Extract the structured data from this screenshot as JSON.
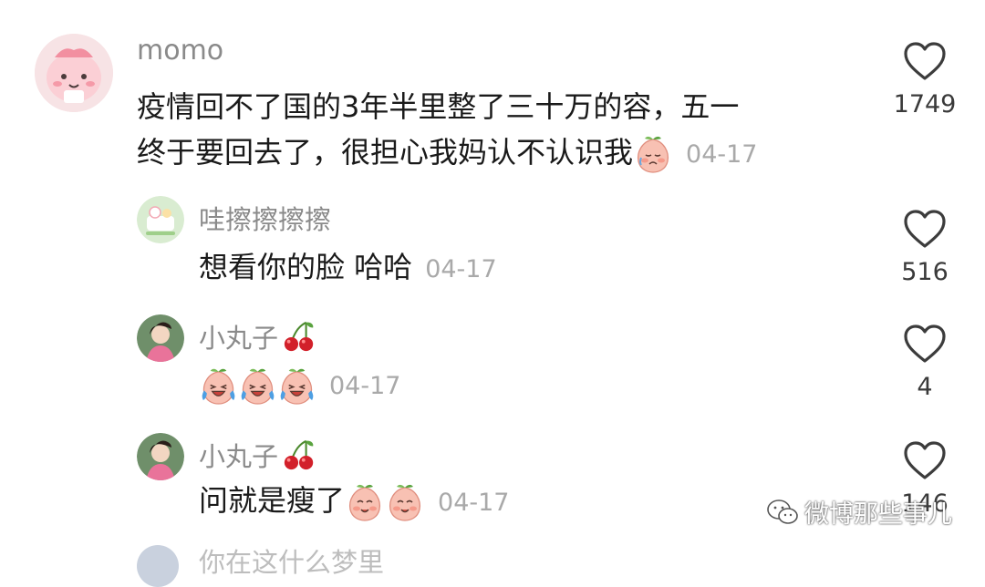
{
  "comments": [
    {
      "user": "momo",
      "text_line1": "疫情回不了国的3年半里整了三十万的容，五一",
      "text_line2": "终于要回去了，很担心我妈认不认识我",
      "emoji": "crying-peach-emoji",
      "time": "04-17",
      "likes": "1749"
    },
    {
      "user": "哇擦擦擦擦",
      "text": "想看你的脸 哈哈",
      "time": "04-17",
      "likes": "516"
    },
    {
      "user": "小丸子",
      "user_emoji": "cherry-emoji",
      "emojis": [
        "laughing-crying-peach-emoji",
        "laughing-crying-peach-emoji",
        "laughing-crying-peach-emoji"
      ],
      "time": "04-17",
      "likes": "4"
    },
    {
      "user": "小丸子",
      "user_emoji": "cherry-emoji",
      "text": "问就是瘦了",
      "emojis": [
        "smiling-peach-emoji",
        "smiling-peach-emoji"
      ],
      "time": "04-17",
      "likes": "146"
    }
  ],
  "partial_next_comment": "你在这什么梦里",
  "watermark": "微博那些事儿",
  "icons": {
    "like": "heart-outline-icon",
    "watermark": "wechat-icon"
  },
  "colors": {
    "username": "#8a8a8a",
    "text": "#1a1a1a",
    "timestamp": "#a9a9a9"
  }
}
